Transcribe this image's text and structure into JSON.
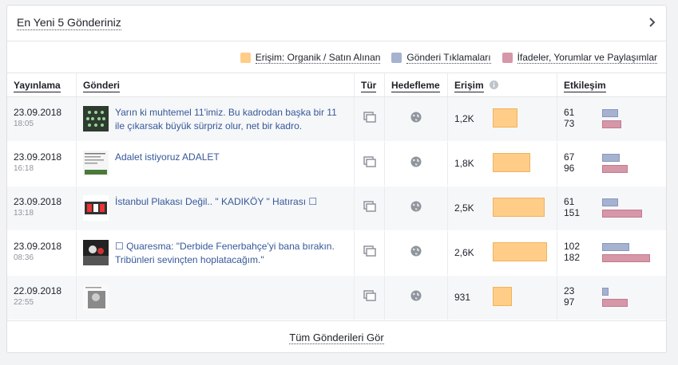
{
  "card": {
    "title": "En Yeni 5 Gönderiniz",
    "footer_link": "Tüm Gönderileri Gör"
  },
  "legend": [
    {
      "label": "Erişim: Organik / Satın Alınan",
      "color": "#ffcd88"
    },
    {
      "label": "Gönderi Tıklamaları",
      "color": "#a5b2d0"
    },
    {
      "label": "İfadeler, Yorumlar ve Paylaşımlar",
      "color": "#d697a8"
    }
  ],
  "columns": {
    "date": "Yayınlama",
    "post": "Gönderi",
    "type": "Tür",
    "targeting": "Hedefleme",
    "reach": "Erişim",
    "engagement": "Etkileşim"
  },
  "icons": {
    "type": "photo-album-icon",
    "targeting": "globe-icon",
    "info": "info-icon",
    "chevron": "chevron-right-icon"
  },
  "rows": [
    {
      "date": "23.09.2018",
      "time": "18:05",
      "text": "Yarın ki muhtemel 11'imiz. Bu kadrodan başka bir 11 ile çıkarsak büyük sürpriz olur, net bir kadro.",
      "reach": "1,2K",
      "reach_value": 1200,
      "clicks": "61",
      "clicks_value": 61,
      "reactions": "73",
      "reactions_value": 73
    },
    {
      "date": "23.09.2018",
      "time": "16:18",
      "text": "Adalet istiyoruz ADALET",
      "reach": "1,8K",
      "reach_value": 1800,
      "clicks": "67",
      "clicks_value": 67,
      "reactions": "96",
      "reactions_value": 96
    },
    {
      "date": "23.09.2018",
      "time": "13:18",
      "text": "İstanbul Plakası Değil.. \" KADIKÖY \" Hatırası ☐",
      "reach": "2,5K",
      "reach_value": 2500,
      "clicks": "61",
      "clicks_value": 61,
      "reactions": "151",
      "reactions_value": 151
    },
    {
      "date": "23.09.2018",
      "time": "08:36",
      "text": "☐ Quaresma: \"Derbide Fenerbahçe'yi bana bırakın. Tribünleri sevinçten hoplatacağım.\"",
      "reach": "2,6K",
      "reach_value": 2600,
      "clicks": "102",
      "clicks_value": 102,
      "reactions": "182",
      "reactions_value": 182
    },
    {
      "date": "22.09.2018",
      "time": "22:55",
      "text": "",
      "reach": "931",
      "reach_value": 931,
      "clicks": "23",
      "clicks_value": 23,
      "reactions": "97",
      "reactions_value": 97
    }
  ]
}
